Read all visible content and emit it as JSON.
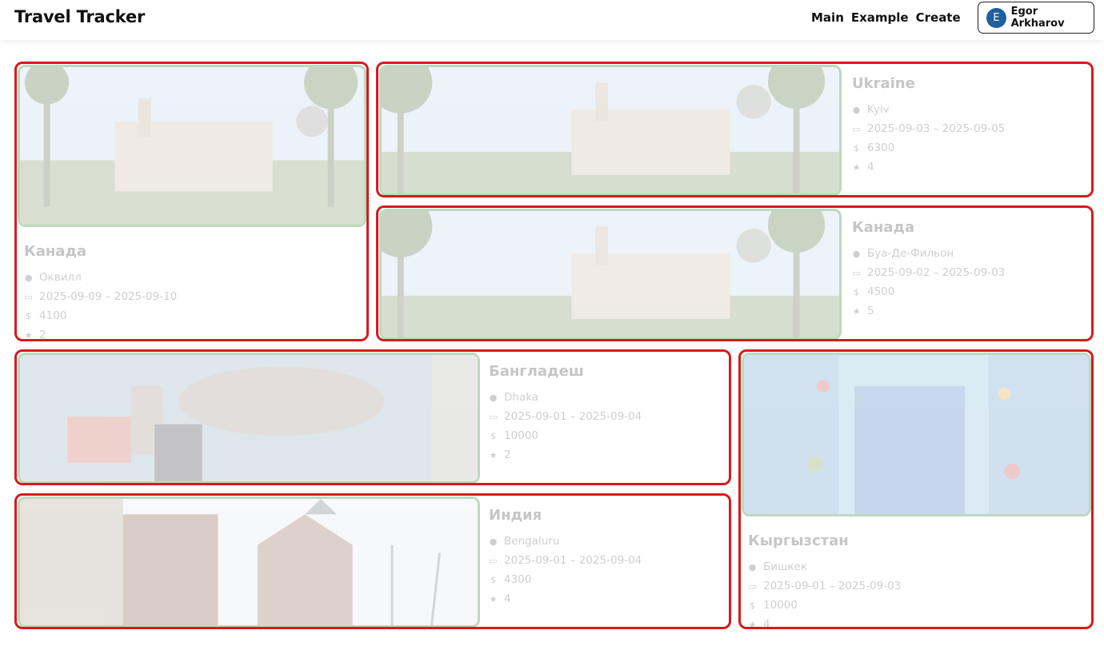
{
  "app": {
    "title": "Travel Tracker"
  },
  "nav": {
    "main": "Main",
    "example": "Example",
    "create": "Create"
  },
  "user": {
    "initial": "E",
    "name": "Egor Arkharov"
  },
  "icons": {
    "city": "globe-icon",
    "dates": "calendar-icon",
    "cost": "dollar-icon",
    "rating": "star-icon"
  },
  "trips": [
    {
      "country": "Канада",
      "city": "Оквилл",
      "dates": "2025-09-09 – 2025-09-10",
      "cost": "4100",
      "rating": "2"
    },
    {
      "country": "Ukraine",
      "city": "Kyiv",
      "dates": "2025-09-03 – 2025-09-05",
      "cost": "6300",
      "rating": "4"
    },
    {
      "country": "Канада",
      "city": "Буа-Де-Фильон",
      "dates": "2025-09-02 – 2025-09-03",
      "cost": "4500",
      "rating": "5"
    },
    {
      "country": "Бангладеш",
      "city": "Dhaka",
      "dates": "2025-09-01 – 2025-09-04",
      "cost": "10000",
      "rating": "2"
    },
    {
      "country": "Кыргызстан",
      "city": "Бишкек",
      "dates": "2025-09-01 – 2025-09-03",
      "cost": "10000",
      "rating": "4"
    },
    {
      "country": "Индия",
      "city": "Bengaluru",
      "dates": "2025-09-01 – 2025-09-04",
      "cost": "4300",
      "rating": "4"
    }
  ]
}
